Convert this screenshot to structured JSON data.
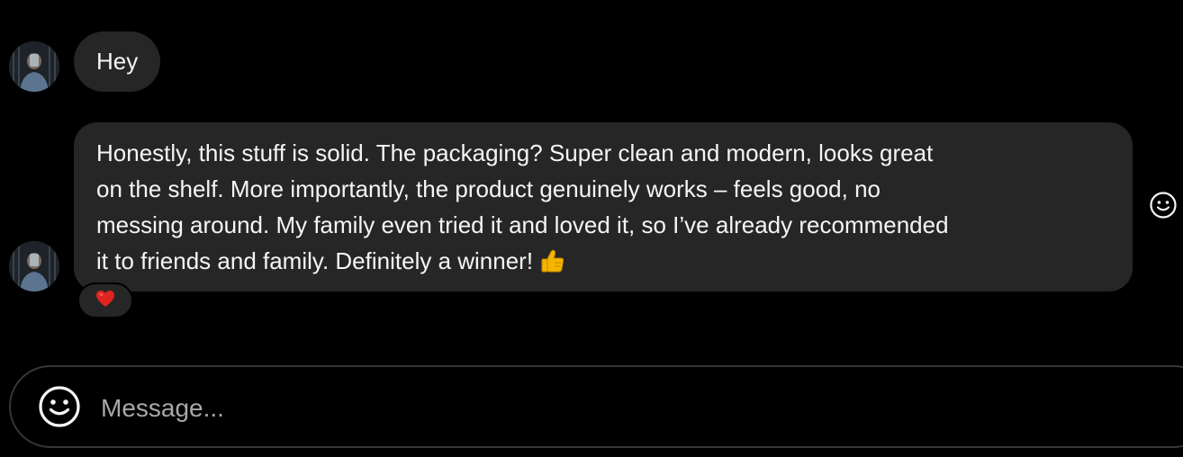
{
  "thread": {
    "messages": [
      {
        "text_lines": [
          "Hey"
        ]
      },
      {
        "text_lines": [
          "Honestly, this stuff is solid. The packaging? Super clean and modern, looks great",
          "on the shelf. More importantly, the product genuinely works – feels good, no",
          "messing around. My family even tried it and loved it, so I’ve already recommended",
          "it to friends and family. Definitely a winner!"
        ],
        "reaction": "heart-emoji"
      }
    ],
    "message_icons": {
      "thumbs_up": "thumbs-up-emoji",
      "react": "smiley-icon"
    }
  },
  "composer": {
    "placeholder": "Message...",
    "value": "",
    "emoji_icon": "smiley-icon"
  },
  "colors": {
    "background": "#000000",
    "bubble": "#262626",
    "text": "#f5f5f5",
    "placeholder": "#a8a8a8",
    "composer_border": "#363636",
    "heart": "#e0241f",
    "thumbs_up": "#f4b400"
  }
}
